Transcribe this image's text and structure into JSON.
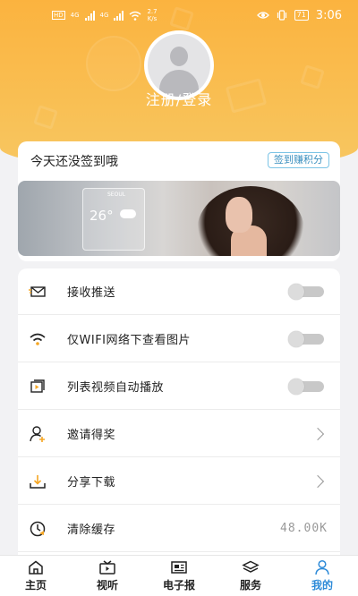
{
  "status_bar": {
    "sim1": "HD",
    "sim2": "HD",
    "net1": "4G",
    "net2": "4G",
    "speed_value": "2.7",
    "speed_unit": "K/s",
    "battery": "71",
    "time": "3:06"
  },
  "profile": {
    "login_label": "注册/登录"
  },
  "checkin": {
    "message": "今天还没签到哦",
    "button_label": "签到赚积分",
    "banner": {
      "city": "SEOUL",
      "temperature": "26°"
    }
  },
  "settings": {
    "items": [
      {
        "label": "接收推送",
        "icon": "envelope-icon",
        "control": "toggle",
        "on": false
      },
      {
        "label": "仅WIFI网络下查看图片",
        "icon": "wifi-icon",
        "control": "toggle",
        "on": false
      },
      {
        "label": "列表视频自动播放",
        "icon": "video-play-icon",
        "control": "toggle",
        "on": false
      },
      {
        "label": "邀请得奖",
        "icon": "invite-user-icon",
        "control": "chevron"
      },
      {
        "label": "分享下载",
        "icon": "download-icon",
        "control": "chevron"
      },
      {
        "label": "清除缓存",
        "icon": "clear-cache-icon",
        "control": "value",
        "value": "48.00K"
      }
    ]
  },
  "tabbar": {
    "tabs": [
      {
        "label": "主页",
        "icon": "home-icon",
        "active": false
      },
      {
        "label": "视听",
        "icon": "tv-icon",
        "active": false
      },
      {
        "label": "电子报",
        "icon": "newspaper-icon",
        "active": false
      },
      {
        "label": "服务",
        "icon": "layers-icon",
        "active": false
      },
      {
        "label": "我的",
        "icon": "user-icon",
        "active": true
      }
    ]
  },
  "colors": {
    "header_orange": "#fbb33f",
    "accent_blue": "#2e8bd8",
    "checkin_button_border": "#7cc4e6"
  }
}
